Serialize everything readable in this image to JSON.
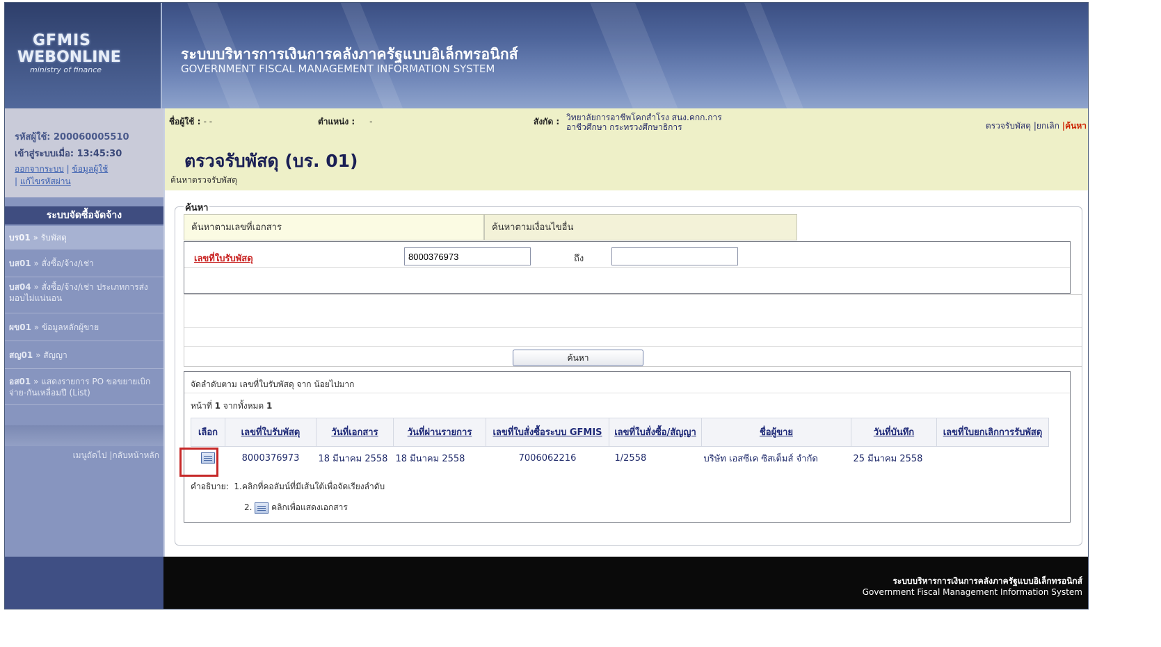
{
  "brand": {
    "logo_main": "GFMIS",
    "logo_sub": "WEBONLINE",
    "logo_tag": "ministry of finance",
    "title_th": "ระบบบริหารการเงินการคลังภาครัฐแบบอิเล็กทรอนิกส์",
    "title_en": "GOVERNMENT FISCAL MANAGEMENT INFORMATION SYSTEM"
  },
  "user": {
    "id_label": "รหัสผู้ใช้:",
    "id_value": "200060005510",
    "login_label": "เข้าสู่ระบบเมื่อ:",
    "login_time": "13:45:30",
    "logout": "ออกจากระบบ",
    "profile": "ข้อมูลผู้ใช้",
    "change_password": "แก้ไขรหัสผ่าน"
  },
  "sidebar": {
    "header": "ระบบจัดซื้อจัดจ้าง",
    "items": [
      {
        "code": "บร01",
        "label": "รับพัสดุ"
      },
      {
        "code": "บส01",
        "label": "สั่งซื้อ/จ้าง/เช่า"
      },
      {
        "code": "บส04",
        "label": "สั่งซื้อ/จ้าง/เช่า ประเภทการส่งมอบไม่แน่นอน"
      },
      {
        "code": "ผข01",
        "label": "ข้อมูลหลักผู้ขาย"
      },
      {
        "code": "สญ01",
        "label": "สัญญา"
      },
      {
        "code": "อส01",
        "label": "แสดงรายการ PO ขอขยายเบิกจ่าย-กันเหลื่อมปี (List)"
      }
    ],
    "sep": "»",
    "nav_next": "เมนูถัดไป",
    "nav_home": "|กลับหน้าหลัก"
  },
  "info": {
    "user_label": "ชื่อผู้ใช้ :",
    "user_value": "- -",
    "position_label": "ตำแหน่ง :",
    "position_value": "-",
    "org_label": "สังกัด :",
    "org_line1": "วิทยาลัยการอาชีพโคกสำโรง สนง.คกก.การ",
    "org_line2": "อาชีวศึกษา กระทรวงศึกษาธิการ",
    "action_inspect": "ตรวจรับพัสดุ",
    "action_cancel": "|ยกเลิก",
    "action_search": "|ค้นหา"
  },
  "page": {
    "title": "ตรวจรับพัสดุ (บร. 01)",
    "subtitle": "ค้นหาตรวจรับพัสดุ"
  },
  "search": {
    "legend": "ค้นหา",
    "tab_by_doc": "ค้นหาตามเลขที่เอกสาร",
    "tab_by_other": "ค้นหาตามเงื่อนไขอื่น",
    "field_label": "เลขที่ใบรับพัสดุ",
    "from_value": "8000376973",
    "to_label": "ถึง",
    "to_value": "",
    "button": "ค้นหา"
  },
  "results": {
    "sort_text": "จัดลำดับตาม เลขที่ใบรับพัสดุ จาก น้อยไปมาก",
    "page_label": "หน้าที่",
    "page_current": "1",
    "page_of": "จากทั้งหมด",
    "page_total": "1",
    "columns": [
      "เลือก",
      "เลขที่ใบรับพัสดุ",
      "วันที่เอกสาร",
      "วันที่ผ่านรายการ",
      "เลขที่ใบสั่งซื้อระบบ GFMIS",
      "เลขที่ใบสั่งซื้อ/สัญญา",
      "ชื่อผู้ขาย",
      "วันที่บันทึก",
      "เลขที่ใบยกเลิกการรับพัสดุ"
    ],
    "rows": [
      {
        "receipt_no": "8000376973",
        "doc_date": "18 มีนาคม 2558",
        "post_date": "18 มีนาคม 2558",
        "po_gfmis": "7006062216",
        "po_contract": "1/2558",
        "vendor": "บริษัท เอสซีเค ซิสเต็มส์ จำกัด",
        "record_date": "25 มีนาคม 2558",
        "cancel_no": ""
      }
    ],
    "note_label": "คำอธิบาย:",
    "note1": "1.คลิกที่คอลัมน์ที่มีเส้นใต้เพื่อจัดเรียงลำดับ",
    "note2_num": "2.",
    "note2": "คลิกเพื่อแสดงเอกสาร"
  },
  "footer": {
    "line_th": "ระบบบริหารการเงินการคลังภาครัฐแบบอิเล็กทรอนิกส์",
    "line_en": "Government Fiscal Management Information System"
  }
}
